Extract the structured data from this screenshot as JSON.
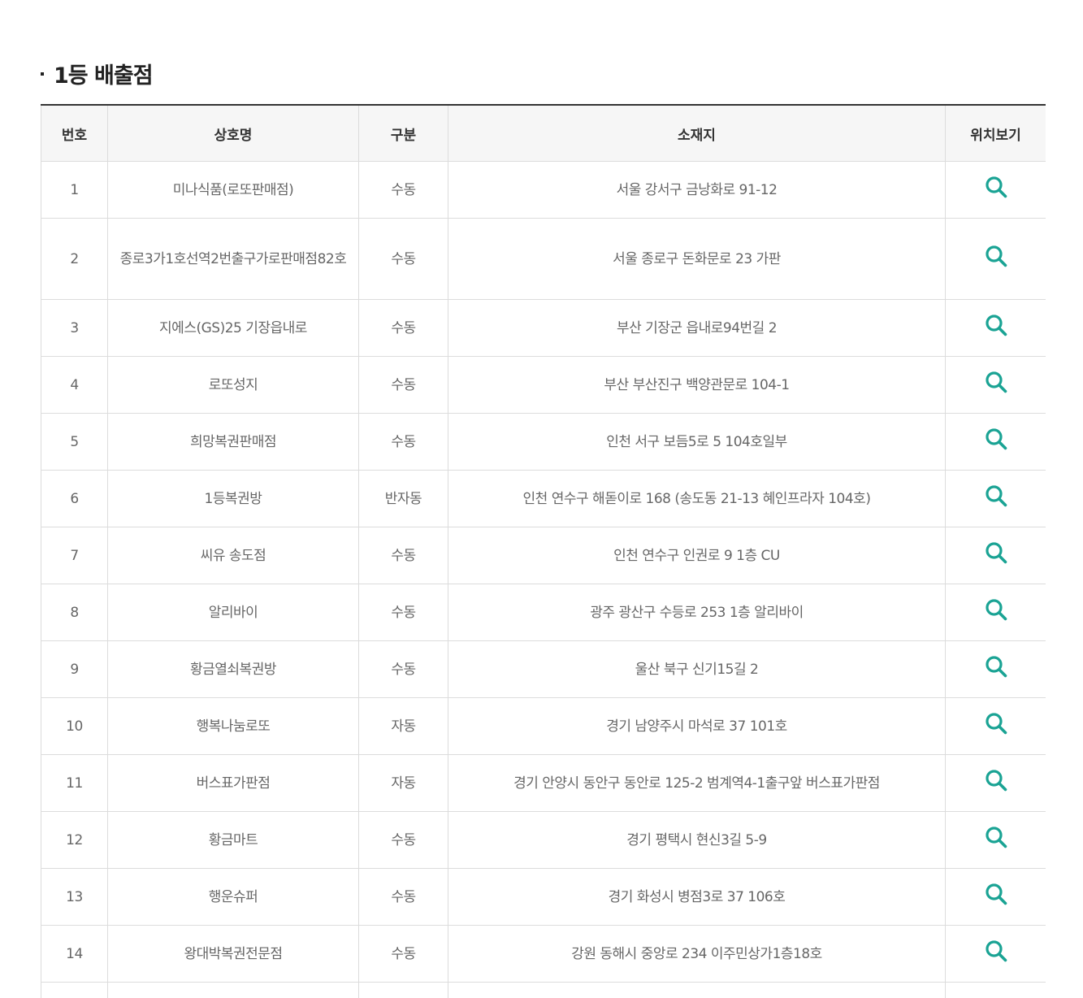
{
  "section": {
    "title": "1등 배출점"
  },
  "table": {
    "headers": {
      "no": "번호",
      "name": "상호명",
      "type": "구분",
      "address": "소재지",
      "location": "위치보기"
    },
    "rows": [
      {
        "no": "1",
        "name": "미나식품(로또판매점)",
        "type": "수동",
        "address": "서울 강서구 금낭화로 91-12"
      },
      {
        "no": "2",
        "name": "종로3가1호선역2번출구가로판매점82호",
        "type": "수동",
        "address": "서울 종로구 돈화문로 23 가판"
      },
      {
        "no": "3",
        "name": "지에스(GS)25 기장읍내로",
        "type": "수동",
        "address": "부산 기장군 읍내로94번길 2"
      },
      {
        "no": "4",
        "name": "로또성지",
        "type": "수동",
        "address": "부산 부산진구 백양관문로 104-1"
      },
      {
        "no": "5",
        "name": "희망복권판매점",
        "type": "수동",
        "address": "인천 서구 보듬5로 5 104호일부"
      },
      {
        "no": "6",
        "name": "1등복권방",
        "type": "반자동",
        "address": "인천 연수구 해돋이로 168 (송도동 21-13 혜인프라자 104호)"
      },
      {
        "no": "7",
        "name": "씨유 송도점",
        "type": "수동",
        "address": "인천 연수구 인권로 9 1층 CU"
      },
      {
        "no": "8",
        "name": "알리바이",
        "type": "수동",
        "address": "광주 광산구 수등로 253 1층 알리바이"
      },
      {
        "no": "9",
        "name": "황금열쇠복권방",
        "type": "수동",
        "address": "울산 북구 신기15길 2"
      },
      {
        "no": "10",
        "name": "행복나눔로또",
        "type": "자동",
        "address": "경기 남양주시 마석로 37 101호"
      },
      {
        "no": "11",
        "name": "버스표가판점",
        "type": "자동",
        "address": "경기 안양시 동안구 동안로 125-2 범계역4-1출구앞 버스표가판점"
      },
      {
        "no": "12",
        "name": "황금마트",
        "type": "수동",
        "address": "경기 평택시 현신3길 5-9"
      },
      {
        "no": "13",
        "name": "행운슈퍼",
        "type": "수동",
        "address": "경기 화성시 병점3로 37 106호"
      },
      {
        "no": "14",
        "name": "왕대박복권전문점",
        "type": "수동",
        "address": "강원 동해시 중앙로 234 이주민상가1층18호"
      },
      {
        "no": "",
        "name": "",
        "type": "",
        "address": ""
      }
    ]
  },
  "colors": {
    "icon": "#1aa394",
    "header_bg": "#f6f6f6",
    "border": "#dcdcdc",
    "top_border": "#333333"
  },
  "icons": {
    "location": "search-icon"
  }
}
